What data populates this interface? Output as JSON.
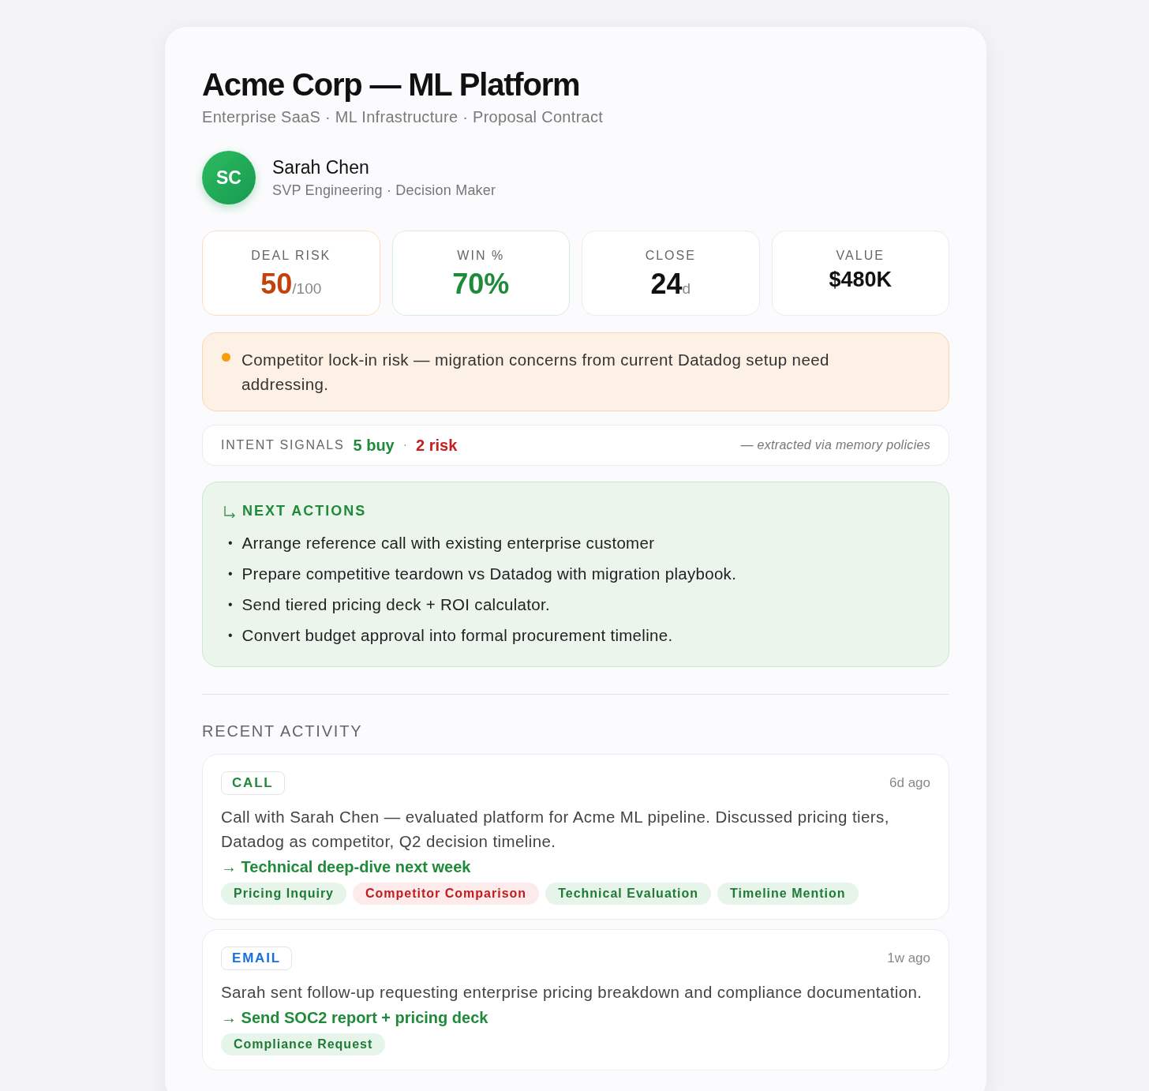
{
  "title": "Acme Corp — ML Platform",
  "subtitle": "Enterprise SaaS · ML Infrastructure · Proposal Contract",
  "contact": {
    "initials": "SC",
    "name": "Sarah Chen",
    "role": "SVP Engineering · Decision Maker"
  },
  "metrics": [
    {
      "label": "DEAL RISK",
      "value": "50",
      "unit": "/100",
      "kind": "risk"
    },
    {
      "label": "WIN %",
      "value": "70%",
      "kind": "win"
    },
    {
      "label": "CLOSE",
      "value": "24",
      "unit": "d",
      "kind": "neutral"
    },
    {
      "label": "VALUE",
      "value": "$480K",
      "kind": "plain"
    }
  ],
  "alert": {
    "text": "Competitor lock-in risk — migration concerns from current Datadog setup need addressing.",
    "color": "#f59e0b"
  },
  "intent": {
    "label": "INTENT SIGNALS",
    "buy": "5 buy",
    "separator": "·",
    "risk": "2 risk",
    "note": "— extracted via memory policies"
  },
  "next_actions": {
    "title": "NEXT ACTIONS",
    "items": [
      {
        "bullet": "•",
        "text": "Arrange reference call with existing enterprise customer"
      },
      {
        "bullet": "•",
        "text": "Prepare competitive teardown vs Datadog with migration playbook."
      },
      {
        "bullet": "•",
        "text": "Send tiered pricing deck + ROI calculator."
      },
      {
        "bullet": "•",
        "text": "Convert budget approval into formal procurement timeline."
      }
    ]
  },
  "recent_activity": {
    "title": "RECENT ACTIVITY",
    "items": [
      {
        "type": "CALL",
        "kind": "call",
        "time": "6d ago",
        "text": "Call with Sarah Chen — evaluated platform for Acme ML pipeline. Discussed pricing tiers, Datadog as competitor, Q2 decision timeline.",
        "next": "→ Technical deep-dive next week",
        "tags": [
          {
            "label": "Pricing Inquiry",
            "kind": "buy"
          },
          {
            "label": "Competitor Comparison",
            "kind": "risk"
          },
          {
            "label": "Technical Evaluation",
            "kind": "buy"
          },
          {
            "label": "Timeline Mention",
            "kind": "buy"
          }
        ]
      },
      {
        "type": "EMAIL",
        "kind": "email",
        "time": "1w ago",
        "text": "Sarah sent follow-up requesting enterprise pricing breakdown and compliance documentation.",
        "next": "→ Send SOC2 report + pricing deck",
        "tags": [
          {
            "label": "Compliance Request",
            "kind": "buy"
          }
        ]
      }
    ]
  }
}
